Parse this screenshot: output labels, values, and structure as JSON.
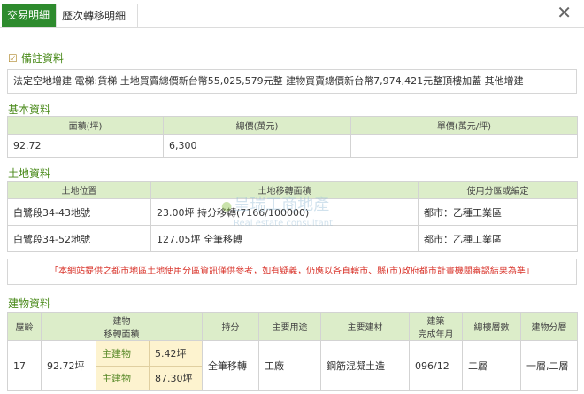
{
  "tabs": {
    "active": "交易明細",
    "inactive": "歷次轉移明細"
  },
  "close_label": "✕",
  "remarks": {
    "title": "備註資料",
    "text": "法定空地增建 電梯:貨梯 土地買賣總價新台幣55,025,579元整 建物買賣總價新台幣7,974,421元整頂樓加蓋 其他增建"
  },
  "basic": {
    "title": "基本資料",
    "headers": [
      "面積(坪)",
      "總價(萬元)",
      "單價(萬元/坪)"
    ],
    "row": [
      "92.72",
      "6,300",
      ""
    ]
  },
  "land": {
    "title": "土地資料",
    "headers": [
      "土地位置",
      "土地移轉面積",
      "使用分區或編定"
    ],
    "rows": [
      [
        "白鷺段34-43地號",
        "23.00坪 持分移轉(7166/100000)",
        "都市：乙種工業區"
      ],
      [
        "白鷺段34-52地號",
        "127.05坪 全筆移轉",
        "都市：乙種工業區"
      ]
    ]
  },
  "watermark": {
    "name": "呈瑞工商地產",
    "sub": "Real estate consultant"
  },
  "warning": "「本網站提供之都市地區土地使用分區資訊僅供參考，如有疑義，仍應以各直轄市、縣(市)政府都市計畫機關審認結果為準」",
  "building": {
    "title": "建物資料",
    "headers": {
      "age": "屋齡",
      "area1": "建物",
      "area2": "移轉面積",
      "share": "持分",
      "use": "主要用途",
      "material": "主要建材",
      "built1": "建築",
      "built2": "完成年月",
      "floors": "總樓層數",
      "split": "建物分層"
    },
    "row": {
      "age": "17",
      "total_area": "92.72坪",
      "sub_items": [
        {
          "name": "主建物",
          "area": "5.42坪"
        },
        {
          "name": "主建物",
          "area": "87.30坪"
        }
      ],
      "share": "全筆移轉",
      "use": "工廠",
      "material": "鋼筋混凝土造",
      "built": "096/12",
      "floors": "二層",
      "split": "一層,二層"
    }
  }
}
